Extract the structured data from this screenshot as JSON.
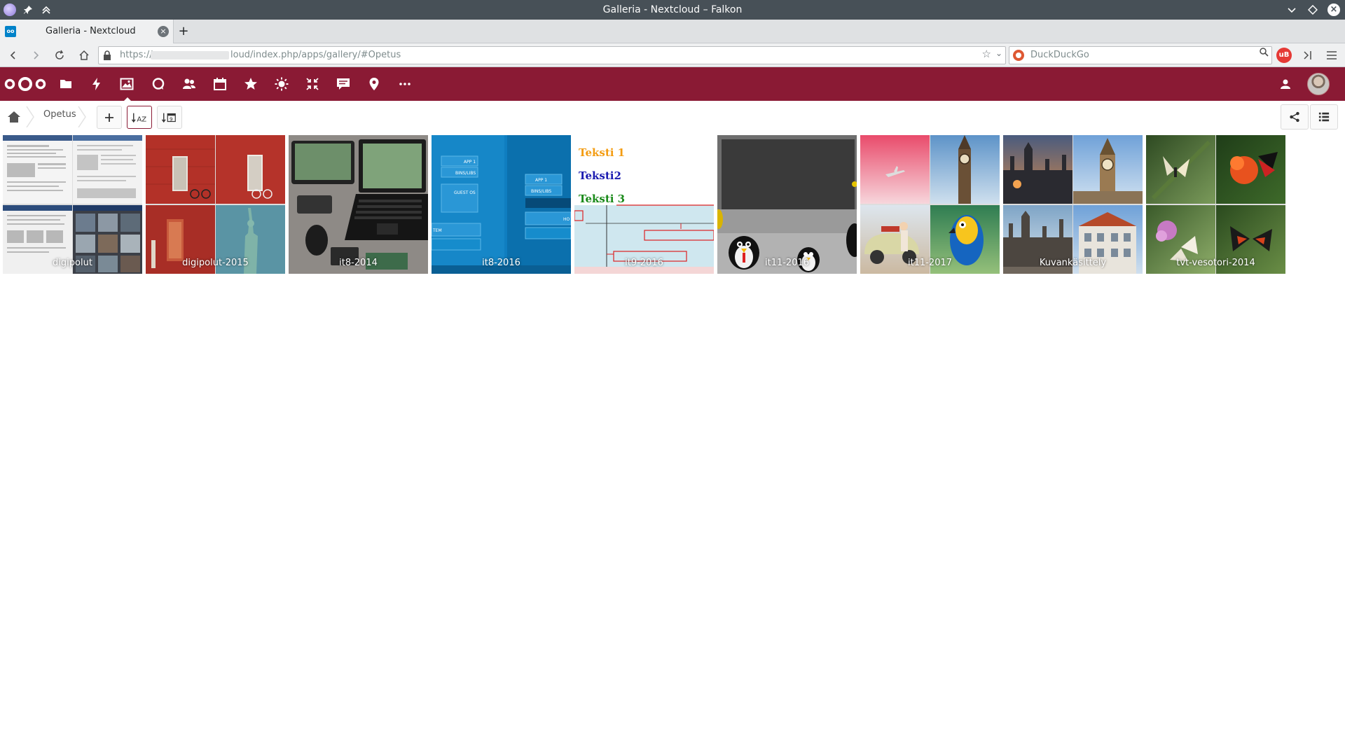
{
  "window": {
    "title": "Galleria - Nextcloud – Falkon"
  },
  "tabs": [
    {
      "label": "Galleria - Nextcloud",
      "favicon": "nextcloud-favicon"
    }
  ],
  "address_bar": {
    "url_prefix": "https://",
    "url_rest": "loud/index.php/apps/gallery/#Opetus"
  },
  "search_bar": {
    "placeholder": "DuckDuckGo"
  },
  "nextcloud": {
    "brand_color": "#8a1a34",
    "apps": [
      {
        "name": "files-icon"
      },
      {
        "name": "activity-icon"
      },
      {
        "name": "gallery-icon",
        "active": true
      },
      {
        "name": "talk-icon"
      },
      {
        "name": "contacts-icon"
      },
      {
        "name": "calendar-icon"
      },
      {
        "name": "favorites-icon"
      },
      {
        "name": "weather-icon"
      },
      {
        "name": "shrink-icon"
      },
      {
        "name": "announcements-icon"
      },
      {
        "name": "maps-icon"
      },
      {
        "name": "more-apps-icon"
      }
    ]
  },
  "gallery": {
    "breadcrumb": [
      "Opetus"
    ],
    "albums": [
      {
        "name": "digipolut"
      },
      {
        "name": "digipolut-2015"
      },
      {
        "name": "it8-2014"
      },
      {
        "name": "it8-2016"
      },
      {
        "name": "it9-2016",
        "texts": [
          "Teksti 1",
          "Teksti2",
          "Teksti 3"
        ]
      },
      {
        "name": "it11-2016"
      },
      {
        "name": "it11-2017"
      },
      {
        "name": "Kuvankäsittely"
      },
      {
        "name": "tvt-vesotori-2014"
      }
    ],
    "diagram_labels": {
      "app1": "APP 1",
      "bins": "BINS/LIBS",
      "guest": "GUEST OS",
      "tem": "TEM",
      "ho": "HO"
    }
  }
}
